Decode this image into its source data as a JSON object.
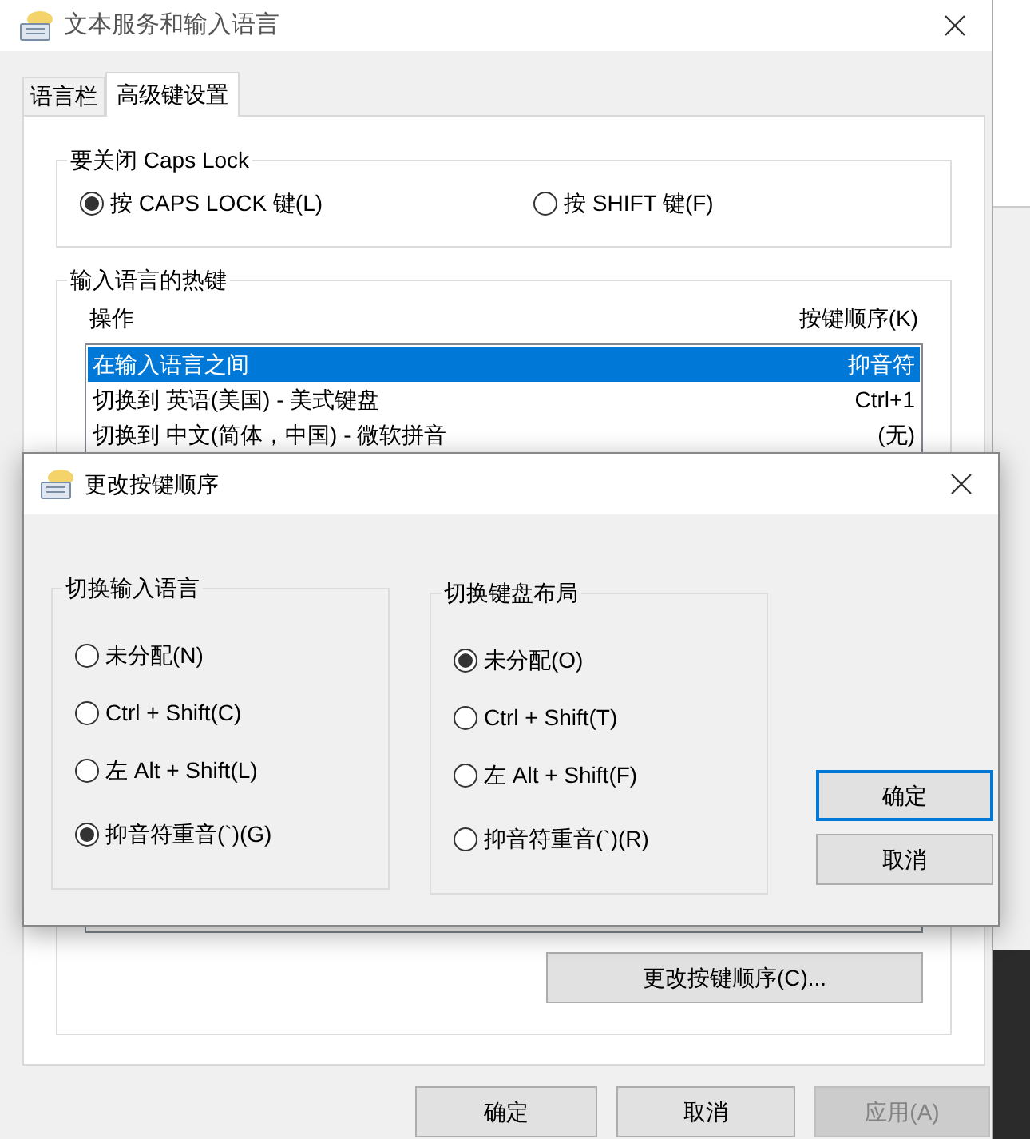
{
  "window": {
    "title": "文本服务和输入语言"
  },
  "tabs": [
    {
      "label": "语言栏",
      "selected": false
    },
    {
      "label": "高级键设置",
      "selected": true
    }
  ],
  "caps_lock": {
    "title": "要关闭 Caps Lock",
    "options": [
      {
        "label": "按 CAPS LOCK 键(L)",
        "selected": true
      },
      {
        "label": "按 SHIFT 键(F)",
        "selected": false
      }
    ]
  },
  "hotkeys": {
    "title": "输入语言的热键",
    "columns": [
      "操作",
      "按键顺序(K)"
    ],
    "rows": [
      {
        "action": "在输入语言之间",
        "keys": "抑音符",
        "selected": true
      },
      {
        "action": "切换到 英语(美国) - 美式键盘",
        "keys": "Ctrl+1",
        "selected": false
      },
      {
        "action": "切换到 中文(简体，中国) - 微软拼音",
        "keys": "(无)",
        "selected": false
      }
    ],
    "button": "更改按键顺序(C)..."
  },
  "buttons": [
    {
      "label": "确定",
      "disabled": false
    },
    {
      "label": "取消",
      "disabled": false
    },
    {
      "label": "应用(A)",
      "disabled": true
    }
  ],
  "dialog": {
    "title": "更改按键顺序",
    "groups": [
      {
        "title": "切换输入语言",
        "options": [
          {
            "label": "未分配(N)",
            "selected": false
          },
          {
            "label": "Ctrl + Shift(C)",
            "selected": false
          },
          {
            "label": "左 Alt + Shift(L)",
            "selected": false
          },
          {
            "label": "抑音符重音(`)(G)",
            "selected": true
          }
        ]
      },
      {
        "title": "切换键盘布局",
        "options": [
          {
            "label": "未分配(O)",
            "selected": true
          },
          {
            "label": "Ctrl + Shift(T)",
            "selected": false
          },
          {
            "label": "左 Alt + Shift(F)",
            "selected": false
          },
          {
            "label": "抑音符重音(`)(R)",
            "selected": false
          }
        ]
      }
    ],
    "buttons": [
      {
        "label": "确定",
        "default": true
      },
      {
        "label": "取消",
        "default": false
      }
    ]
  }
}
